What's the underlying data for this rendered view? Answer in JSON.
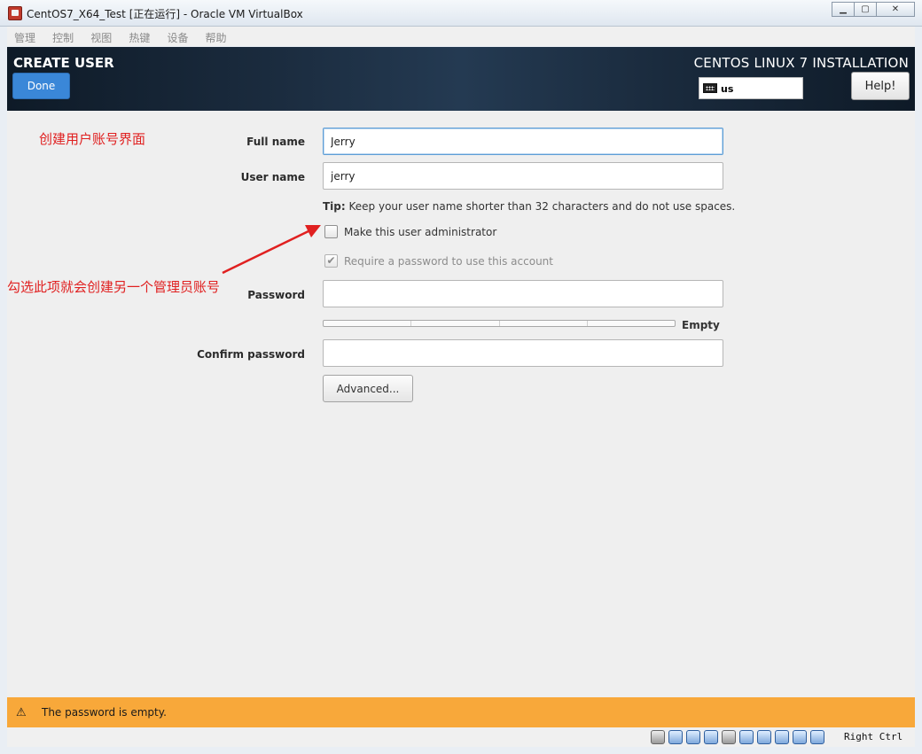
{
  "window": {
    "title": "CentOS7_X64_Test [正在运行] - Oracle VM VirtualBox",
    "minimize": "▁",
    "maximize": "▢",
    "close": "✕"
  },
  "menubar": {
    "items": [
      "管理",
      "控制",
      "视图",
      "热键",
      "设备",
      "帮助"
    ]
  },
  "header": {
    "title": "CREATE USER",
    "done_label": "Done",
    "product": "CENTOS LINUX 7 INSTALLATION",
    "keyboard_layout": "us",
    "help_label": "Help!"
  },
  "form": {
    "full_name_label": "Full name",
    "full_name_value": "Jerry",
    "user_name_label": "User name",
    "user_name_value": "jerry",
    "tip_bold": "Tip:",
    "tip_text": "Keep your user name shorter than 32 characters and do not use spaces.",
    "admin_label": "Make this user administrator",
    "admin_checked": false,
    "require_password_label": "Require a password to use this account",
    "require_password_checked": true,
    "password_label": "Password",
    "password_value": "",
    "strength_text": "Empty",
    "strength_level": 0,
    "confirm_label": "Confirm password",
    "confirm_value": "",
    "advanced_label": "Advanced..."
  },
  "annotations": {
    "top": "创建用户账号界面",
    "arrow_note": "勾选此项就会创建另一个管理员账号"
  },
  "warning": {
    "icon": "⚠",
    "text": "The password is empty."
  },
  "statusbar": {
    "host_key": "Right Ctrl"
  },
  "colors": {
    "accent": "#3a87d8",
    "warning": "#f8a83a",
    "annotation": "#e02020"
  }
}
